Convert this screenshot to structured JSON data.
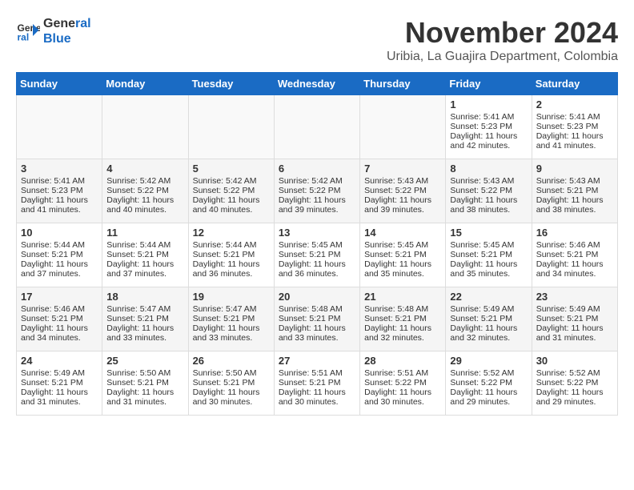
{
  "header": {
    "logo_line1": "General",
    "logo_line2": "Blue",
    "month": "November 2024",
    "location": "Uribia, La Guajira Department, Colombia"
  },
  "days_of_week": [
    "Sunday",
    "Monday",
    "Tuesday",
    "Wednesday",
    "Thursday",
    "Friday",
    "Saturday"
  ],
  "weeks": [
    [
      {
        "day": "",
        "info": ""
      },
      {
        "day": "",
        "info": ""
      },
      {
        "day": "",
        "info": ""
      },
      {
        "day": "",
        "info": ""
      },
      {
        "day": "",
        "info": ""
      },
      {
        "day": "1",
        "info": "Sunrise: 5:41 AM\nSunset: 5:23 PM\nDaylight: 11 hours and 42 minutes."
      },
      {
        "day": "2",
        "info": "Sunrise: 5:41 AM\nSunset: 5:23 PM\nDaylight: 11 hours and 41 minutes."
      }
    ],
    [
      {
        "day": "3",
        "info": "Sunrise: 5:41 AM\nSunset: 5:23 PM\nDaylight: 11 hours and 41 minutes."
      },
      {
        "day": "4",
        "info": "Sunrise: 5:42 AM\nSunset: 5:22 PM\nDaylight: 11 hours and 40 minutes."
      },
      {
        "day": "5",
        "info": "Sunrise: 5:42 AM\nSunset: 5:22 PM\nDaylight: 11 hours and 40 minutes."
      },
      {
        "day": "6",
        "info": "Sunrise: 5:42 AM\nSunset: 5:22 PM\nDaylight: 11 hours and 39 minutes."
      },
      {
        "day": "7",
        "info": "Sunrise: 5:43 AM\nSunset: 5:22 PM\nDaylight: 11 hours and 39 minutes."
      },
      {
        "day": "8",
        "info": "Sunrise: 5:43 AM\nSunset: 5:22 PM\nDaylight: 11 hours and 38 minutes."
      },
      {
        "day": "9",
        "info": "Sunrise: 5:43 AM\nSunset: 5:21 PM\nDaylight: 11 hours and 38 minutes."
      }
    ],
    [
      {
        "day": "10",
        "info": "Sunrise: 5:44 AM\nSunset: 5:21 PM\nDaylight: 11 hours and 37 minutes."
      },
      {
        "day": "11",
        "info": "Sunrise: 5:44 AM\nSunset: 5:21 PM\nDaylight: 11 hours and 37 minutes."
      },
      {
        "day": "12",
        "info": "Sunrise: 5:44 AM\nSunset: 5:21 PM\nDaylight: 11 hours and 36 minutes."
      },
      {
        "day": "13",
        "info": "Sunrise: 5:45 AM\nSunset: 5:21 PM\nDaylight: 11 hours and 36 minutes."
      },
      {
        "day": "14",
        "info": "Sunrise: 5:45 AM\nSunset: 5:21 PM\nDaylight: 11 hours and 35 minutes."
      },
      {
        "day": "15",
        "info": "Sunrise: 5:45 AM\nSunset: 5:21 PM\nDaylight: 11 hours and 35 minutes."
      },
      {
        "day": "16",
        "info": "Sunrise: 5:46 AM\nSunset: 5:21 PM\nDaylight: 11 hours and 34 minutes."
      }
    ],
    [
      {
        "day": "17",
        "info": "Sunrise: 5:46 AM\nSunset: 5:21 PM\nDaylight: 11 hours and 34 minutes."
      },
      {
        "day": "18",
        "info": "Sunrise: 5:47 AM\nSunset: 5:21 PM\nDaylight: 11 hours and 33 minutes."
      },
      {
        "day": "19",
        "info": "Sunrise: 5:47 AM\nSunset: 5:21 PM\nDaylight: 11 hours and 33 minutes."
      },
      {
        "day": "20",
        "info": "Sunrise: 5:48 AM\nSunset: 5:21 PM\nDaylight: 11 hours and 33 minutes."
      },
      {
        "day": "21",
        "info": "Sunrise: 5:48 AM\nSunset: 5:21 PM\nDaylight: 11 hours and 32 minutes."
      },
      {
        "day": "22",
        "info": "Sunrise: 5:49 AM\nSunset: 5:21 PM\nDaylight: 11 hours and 32 minutes."
      },
      {
        "day": "23",
        "info": "Sunrise: 5:49 AM\nSunset: 5:21 PM\nDaylight: 11 hours and 31 minutes."
      }
    ],
    [
      {
        "day": "24",
        "info": "Sunrise: 5:49 AM\nSunset: 5:21 PM\nDaylight: 11 hours and 31 minutes."
      },
      {
        "day": "25",
        "info": "Sunrise: 5:50 AM\nSunset: 5:21 PM\nDaylight: 11 hours and 31 minutes."
      },
      {
        "day": "26",
        "info": "Sunrise: 5:50 AM\nSunset: 5:21 PM\nDaylight: 11 hours and 30 minutes."
      },
      {
        "day": "27",
        "info": "Sunrise: 5:51 AM\nSunset: 5:21 PM\nDaylight: 11 hours and 30 minutes."
      },
      {
        "day": "28",
        "info": "Sunrise: 5:51 AM\nSunset: 5:22 PM\nDaylight: 11 hours and 30 minutes."
      },
      {
        "day": "29",
        "info": "Sunrise: 5:52 AM\nSunset: 5:22 PM\nDaylight: 11 hours and 29 minutes."
      },
      {
        "day": "30",
        "info": "Sunrise: 5:52 AM\nSunset: 5:22 PM\nDaylight: 11 hours and 29 minutes."
      }
    ]
  ]
}
